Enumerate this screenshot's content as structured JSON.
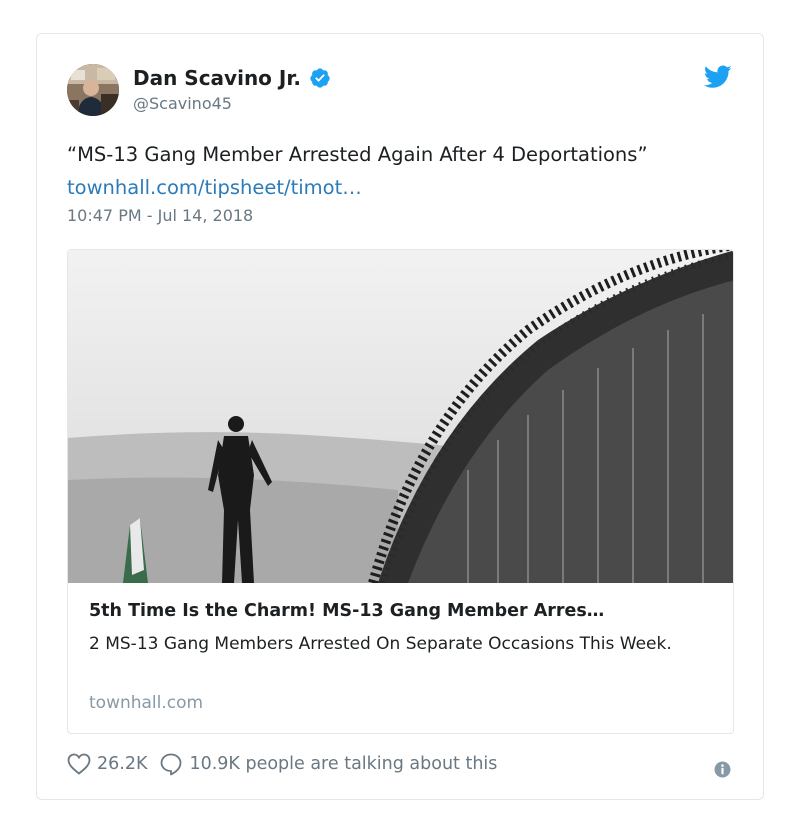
{
  "author": {
    "name": "Dan Scavino Jr.",
    "handle": "@Scavino45",
    "avatar_icon": "avatar-photo",
    "verified_icon": "verified-badge-icon"
  },
  "tweet": {
    "text": "“MS-13 Gang Member Arrested Again After 4 Deportations” ",
    "link": "townhall.com/tipsheet/timot…",
    "timestamp": "10:47 PM - Jul 14, 2018"
  },
  "card": {
    "image_icon": "border-fence-photo",
    "title": "5th Time Is the Charm! MS-13 Gang Member Arres…",
    "description": "2 MS-13 Gang Members Arrested On Separate Occasions This Week.",
    "domain": "townhall.com"
  },
  "actions": {
    "likes": "26.2K",
    "replies": "10.9K people are talking about this"
  },
  "colors": {
    "twitter_blue": "#1da1f2",
    "link_blue": "#2b7bb9",
    "muted_gray": "#697882"
  }
}
